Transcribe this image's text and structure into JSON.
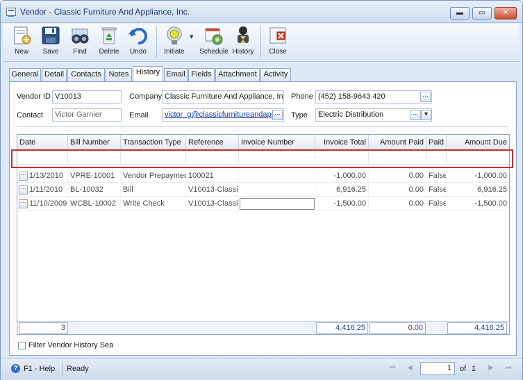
{
  "window": {
    "title": "Vendor - Classic Furniture And Appliance, Inc.",
    "min_glyph": "▬",
    "max_glyph": "▭",
    "close_glyph": "✕"
  },
  "toolbar": {
    "new": "New",
    "save": "Save",
    "find": "Find",
    "delete": "Delete",
    "undo": "Undo",
    "initiate": "Initiate",
    "dropdown_glyph": "▾",
    "schedule": "Schedule",
    "history": "History",
    "close": "Close"
  },
  "tabs": [
    "General",
    "Detail",
    "Contacts",
    "Notes",
    "History",
    "Email",
    "Fields",
    "Attachment",
    "Activity"
  ],
  "active_tab": "History",
  "form": {
    "vendor_id_label": "Vendor ID",
    "vendor_id": "V10013",
    "company_label": "Company",
    "company": "Classic Furniture And Appliance, Inc",
    "phone_label": "Phone",
    "phone": "(452) 158-9643 420",
    "contact_label": "Contact",
    "contact": "Victor Garnier",
    "email_label": "Email",
    "email": "victor_g@classicfurnitureandapp",
    "type_label": "Type",
    "type": "Electric Distribution",
    "ellipsis": "···",
    "select_glyph": "▾"
  },
  "grid": {
    "columns": [
      "Date",
      "Bill Number",
      "Transaction Type",
      "Reference",
      "Invoice Number",
      "Invoice Total",
      "Amount Paid",
      "Paid",
      "Amount Due"
    ],
    "row_button_glyph": "···",
    "rows": [
      {
        "date": "1/13/2010",
        "bill": "VPRE-10001",
        "type": "Vendor Prepaymer",
        "ref": "100021",
        "invoice": "",
        "total": "-1,000.00",
        "paid_amt": "0.00",
        "paid": "False",
        "due": "-1,000.00"
      },
      {
        "date": "1/11/2010",
        "bill": "BL-10032",
        "type": "Bill",
        "ref": "V10013-Classic",
        "invoice": "",
        "total": "6,916.25",
        "paid_amt": "0.00",
        "paid": "False",
        "due": "6,916.25"
      },
      {
        "date": "11/10/2009",
        "bill": "WCBL-10002",
        "type": "Write Check",
        "ref": "V10013-Classic",
        "invoice": "",
        "total": "-1,500.00",
        "paid_amt": "0.00",
        "paid": "False",
        "due": "-1,500.00"
      }
    ],
    "footer": {
      "count": "3",
      "total": "4,416.25",
      "paid_amt": "0.00",
      "due": "4,416.25"
    }
  },
  "filter_label": "Filter Vendor History Sea",
  "status": {
    "help": "F1 - Help",
    "state": "Ready",
    "page": "1",
    "of_label": "of",
    "total_pages": "1",
    "first_glyph": "⏮",
    "prev_glyph": "◀",
    "next_glyph": "▶",
    "last_glyph": "⏭",
    "help_glyph": "?"
  },
  "colors": {
    "accent": "#2f6fc7",
    "highlight_border": "#c43030",
    "link": "#1740b0"
  }
}
